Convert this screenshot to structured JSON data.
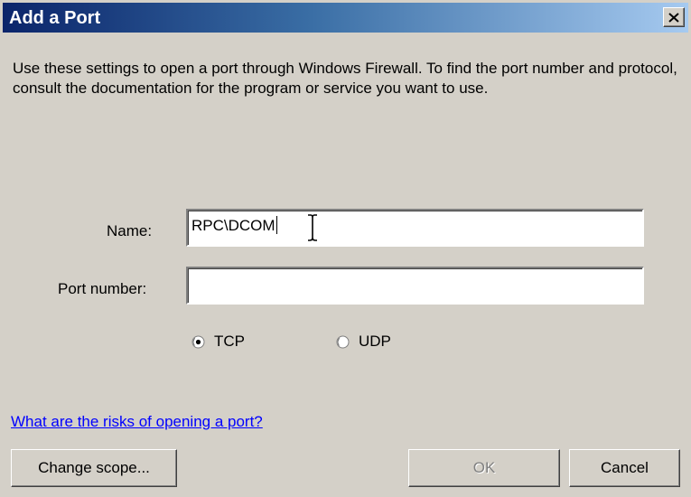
{
  "window": {
    "title": "Add a Port",
    "close_glyph": "X"
  },
  "description": "Use these settings to open a port through Windows Firewall. To find the port number and protocol, consult the documentation for the program or service you want to use.",
  "form": {
    "name_label": "Name:",
    "name_value": "RPC\\DCOM",
    "port_label": "Port number:",
    "port_value": ""
  },
  "protocol": {
    "options": [
      {
        "label": "TCP",
        "selected": true
      },
      {
        "label": "UDP",
        "selected": false
      }
    ]
  },
  "link_text": "What are the risks of opening a port?",
  "buttons": {
    "change_scope": "Change scope...",
    "ok": "OK",
    "ok_enabled": false,
    "cancel": "Cancel"
  },
  "icons": {
    "close": "close-icon",
    "cursor": "text-cursor-icon",
    "radio": "radio-button-icon"
  }
}
